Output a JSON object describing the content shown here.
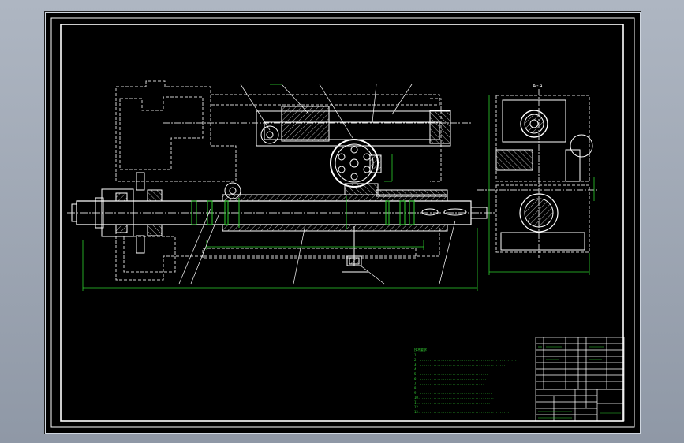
{
  "drawing": {
    "section_label": "A-A",
    "notes_heading": "技术要求",
    "notes": [
      "1. ...................................................",
      "2. ...................................................",
      "3. .............................................",
      "4. ......................................",
      "5. ....................................",
      "6. ...................................",
      "7. ..................................",
      "8. .........................................",
      "9. ......................................",
      "10. .......................................",
      "11. ....................................",
      "12. ..................................",
      "13. ..............................................",
      "14. ..........................................."
    ]
  },
  "colors": {
    "background": "#000000",
    "outline": "#ffffff",
    "dimension": "#2ed12e",
    "hidden_line": "#d9d9d9",
    "section_hatch": "#e0e0e0",
    "window_bg": "#9aa3b0"
  }
}
